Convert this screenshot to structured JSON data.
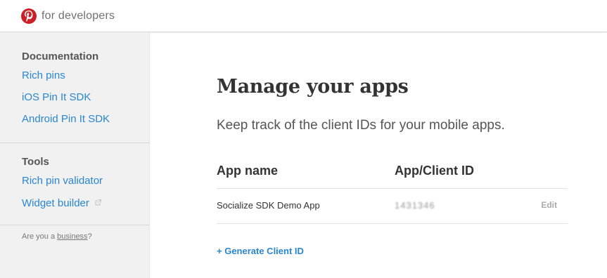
{
  "header": {
    "brand_text": "for developers"
  },
  "sidebar": {
    "documentation": {
      "heading": "Documentation",
      "items": [
        {
          "label": "Rich pins"
        },
        {
          "label": "iOS Pin It SDK"
        },
        {
          "label": "Android Pin It SDK"
        }
      ]
    },
    "tools": {
      "heading": "Tools",
      "items": [
        {
          "label": "Rich pin validator"
        },
        {
          "label": "Widget builder"
        }
      ]
    },
    "note": {
      "prefix": "Are you a ",
      "link": "business",
      "suffix": "?"
    }
  },
  "main": {
    "title": "Manage your apps",
    "subtitle": "Keep track of the client IDs for your mobile apps.",
    "table": {
      "headers": {
        "name": "App name",
        "id": "App/Client ID"
      },
      "rows": [
        {
          "name": "Socialize SDK Demo App",
          "id": "1431346",
          "action": "Edit"
        }
      ]
    },
    "generate_label": "+ Generate Client ID"
  },
  "colors": {
    "brand_red": "#cb2027",
    "link_blue": "#2a86cf",
    "sidebar_bg": "#f1f1f1"
  }
}
